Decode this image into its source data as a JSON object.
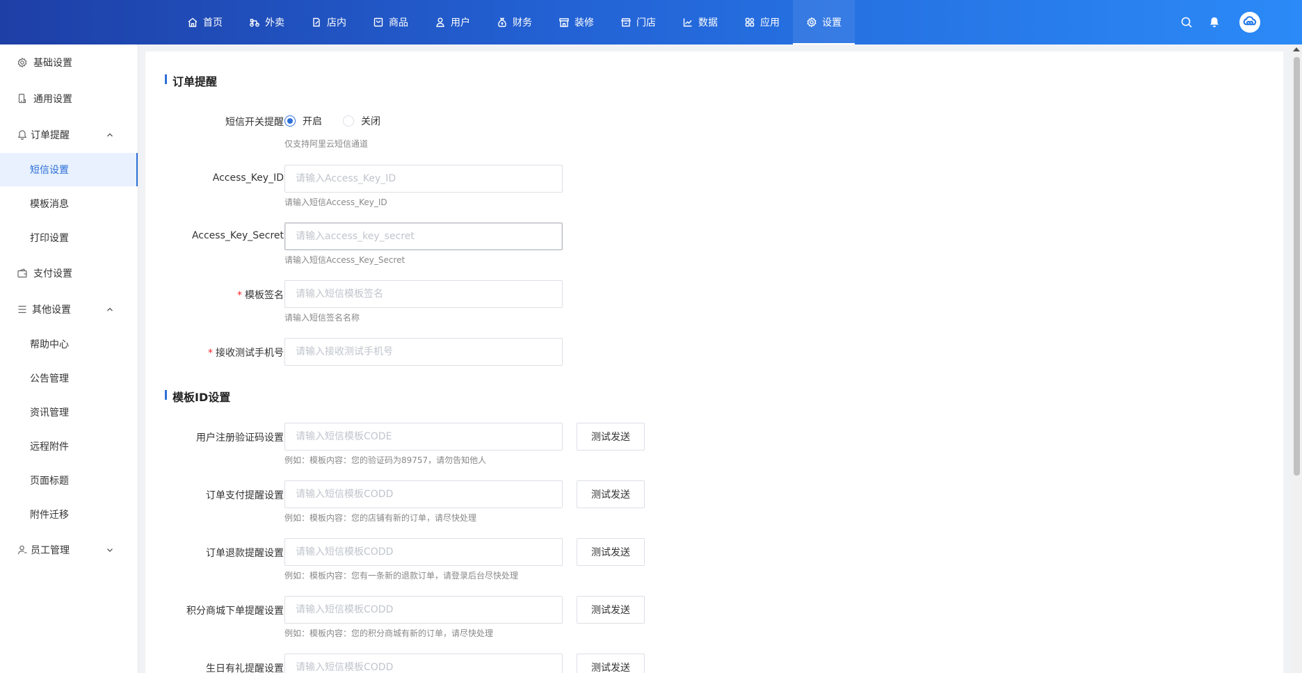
{
  "top_nav": {
    "items": [
      {
        "label": "首页",
        "icon": "home-icon"
      },
      {
        "label": "外卖",
        "icon": "bike-icon"
      },
      {
        "label": "店内",
        "icon": "edit-icon"
      },
      {
        "label": "商品",
        "icon": "bag-icon"
      },
      {
        "label": "用户",
        "icon": "user-icon"
      },
      {
        "label": "财务",
        "icon": "money-bag-icon"
      },
      {
        "label": "装修",
        "icon": "shop-icon"
      },
      {
        "label": "门店",
        "icon": "store-icon"
      },
      {
        "label": "数据",
        "icon": "chart-line-icon"
      },
      {
        "label": "应用",
        "icon": "apps-icon"
      },
      {
        "label": "设置",
        "icon": "gear-icon"
      }
    ],
    "active": "设置"
  },
  "sidebar": {
    "items": [
      {
        "label": "基础设置",
        "icon": "gear-icon"
      },
      {
        "label": "通用设置",
        "icon": "phone-icon"
      },
      {
        "label": "订单提醒",
        "icon": "bell-icon"
      },
      {
        "label": "短信设置"
      },
      {
        "label": "模板消息"
      },
      {
        "label": "打印设置"
      },
      {
        "label": "支付设置",
        "icon": "wallet-icon"
      },
      {
        "label": "其他设置",
        "icon": "list-icon"
      },
      {
        "label": "帮助中心"
      },
      {
        "label": "公告管理"
      },
      {
        "label": "资讯管理"
      },
      {
        "label": "远程附件"
      },
      {
        "label": "页面标题"
      },
      {
        "label": "附件迁移"
      },
      {
        "label": "员工管理",
        "icon": "user-icon"
      }
    ]
  },
  "order_reminder": {
    "title": "订单提醒",
    "sms_switch": {
      "label": "短信开关提醒",
      "on_label": "开启",
      "off_label": "关闭",
      "selected": "开启",
      "hint": "仅支持阿里云短信通道"
    },
    "access_key_id": {
      "label": "Access_Key_ID",
      "placeholder": "请输入Access_Key_ID",
      "hint": "请输入短信Access_Key_ID"
    },
    "access_key_secret": {
      "label": "Access_Key_Secret",
      "placeholder": "请输入access_key_secret",
      "hint": "请输入短信Access_Key_Secret"
    },
    "template_sign": {
      "required": "*",
      "label": "模板签名",
      "placeholder": "请输入短信模板签名",
      "hint": "请输入短信签名名称"
    },
    "test_phone": {
      "required": "*",
      "label": "接收测试手机号",
      "placeholder": "请输入接收测试手机号"
    }
  },
  "template_id": {
    "title": "模板ID设置",
    "rows": [
      {
        "label": "用户注册验证码设置",
        "placeholder": "请输入短信模板CODE",
        "button": "测试发送",
        "hint": "例如：模板内容：您的验证码为89757，请勿告知他人"
      },
      {
        "label": "订单支付提醒设置",
        "placeholder": "请输入短信模板CODD",
        "button": "测试发送",
        "hint": "例如：模板内容：您的店铺有新的订单，请尽快处理"
      },
      {
        "label": "订单退款提醒设置",
        "placeholder": "请输入短信模板CODD",
        "button": "测试发送",
        "hint": "例如：模板内容：您有一条新的退款订单，请登录后台尽快处理"
      },
      {
        "label": "积分商城下单提醒设置",
        "placeholder": "请输入短信模板CODD",
        "button": "测试发送",
        "hint": "例如：模板内容：您的积分商城有新的订单，请尽快处理"
      },
      {
        "label": "生日有礼提醒设置",
        "placeholder": "请输入短信模板CODD",
        "button": "测试发送"
      }
    ]
  },
  "colors": {
    "header_start": "#1e3fa6",
    "header_end": "#2b8af7",
    "accent": "#2d6fd8",
    "required": "#f5222d"
  }
}
